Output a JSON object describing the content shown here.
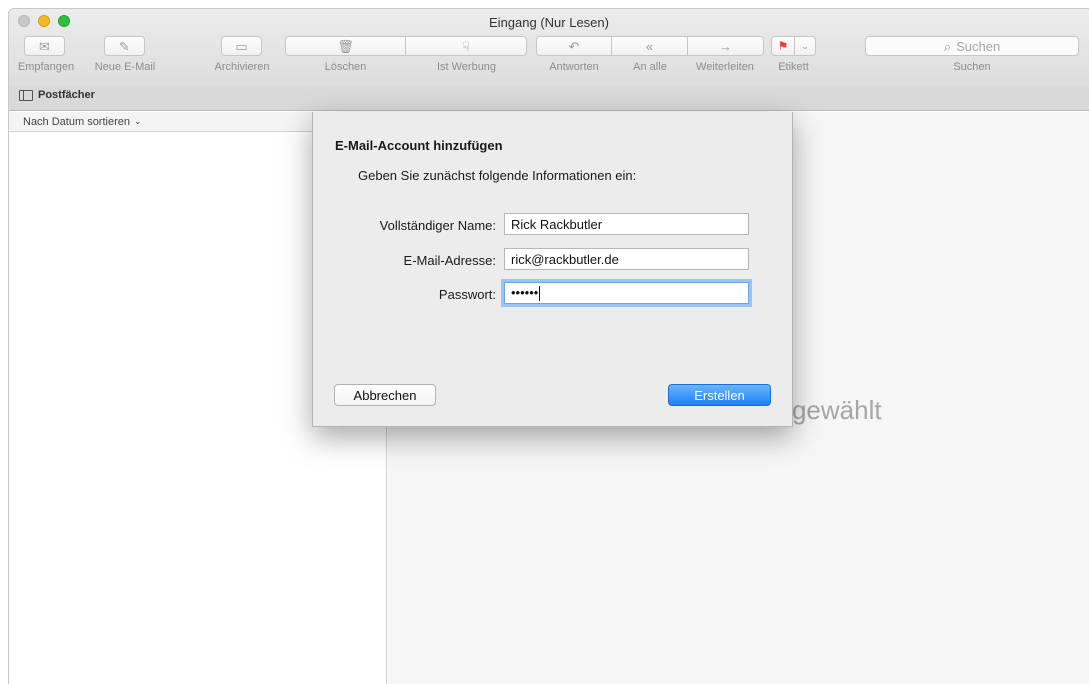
{
  "window": {
    "title": "Eingang (Nur Lesen)"
  },
  "toolbar": {
    "receive": "Empfangen",
    "new_mail": "Neue E-Mail",
    "archive": "Archivieren",
    "delete": "Löschen",
    "junk": "Ist Werbung",
    "reply": "Antworten",
    "reply_all": "An alle",
    "forward": "Weiterleiten",
    "flag": "Etikett",
    "search_placeholder": "Suchen",
    "search_label": "Suchen"
  },
  "favorites": {
    "mailboxes": "Postfächer"
  },
  "list": {
    "sort_label": "Nach Datum sortieren"
  },
  "preview": {
    "empty_text": "Keine E-Mail ausgewählt"
  },
  "dialog": {
    "title": "E-Mail-Account hinzufügen",
    "intro": "Geben Sie zunächst folgende Informationen ein:",
    "name_label": "Vollständiger Name:",
    "name_value": "Rick Rackbutler",
    "email_label": "E-Mail-Adresse:",
    "email_value": "rick@rackbutler.de",
    "password_label": "Passwort:",
    "password_value": "••••••",
    "cancel": "Abbrechen",
    "create": "Erstellen"
  },
  "colors": {
    "accent": "#1d82f6",
    "flag": "#ee3d4a"
  },
  "icons": {
    "receive": "envelope-icon",
    "new_mail": "compose-icon",
    "archive": "archive-box-icon",
    "delete": "trash-icon",
    "junk": "thumbs-down-icon",
    "reply": "reply-arrow-icon",
    "reply_all": "reply-all-icon",
    "forward": "forward-arrow-icon",
    "flag": "flag-icon",
    "search": "magnifier-icon"
  }
}
